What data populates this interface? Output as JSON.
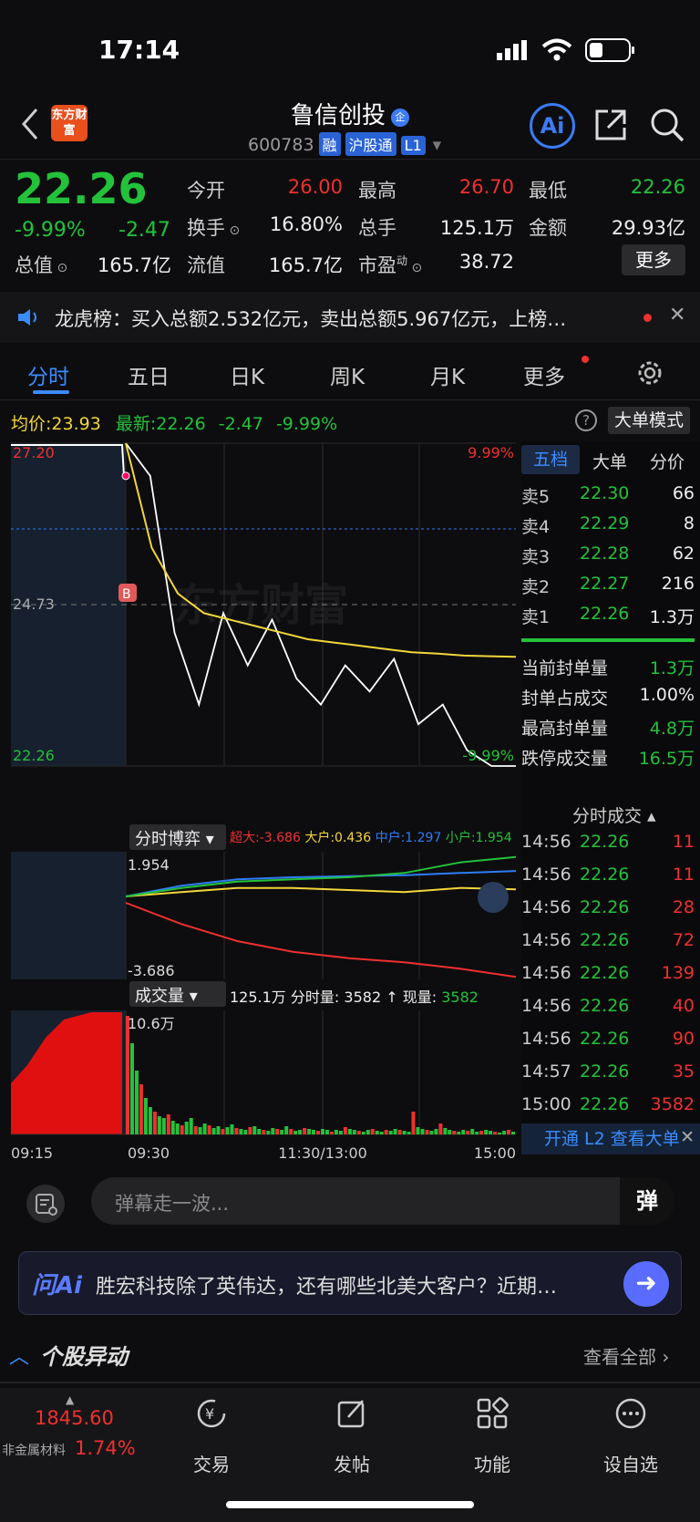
{
  "status": {
    "time": "17:14"
  },
  "header": {
    "title": "鲁信创投",
    "qi_badge": "企",
    "code": "600783",
    "tags": [
      "融",
      "沪股通",
      "L1"
    ],
    "logo_text": "东方财富",
    "ai_label": "Ai"
  },
  "quote": {
    "price": "22.26",
    "pct": "-9.99%",
    "chg": "-2.47",
    "row1": [
      {
        "label": "今开",
        "value": "26.00",
        "color": "red"
      },
      {
        "label": "最高",
        "value": "26.70",
        "color": "red"
      },
      {
        "label": "最低",
        "value": "22.26",
        "color": "green"
      }
    ],
    "row2": [
      {
        "label": "换手",
        "value": "16.80%"
      },
      {
        "label": "总手",
        "value": "125.1万"
      },
      {
        "label": "金额",
        "value": "29.93亿"
      }
    ],
    "row3": [
      {
        "label": "总值",
        "value": "165.7亿"
      },
      {
        "label": "流值",
        "value": "165.7亿"
      },
      {
        "label": "市盈",
        "sup": "动",
        "value": "38.72"
      }
    ],
    "more": "更多"
  },
  "notice": {
    "text": "龙虎榜：买入总额2.532亿元，卖出总额5.967亿元，上榜…"
  },
  "tabs": [
    "分时",
    "五日",
    "日K",
    "周K",
    "月K",
    "更多"
  ],
  "infobar": {
    "avg_label": "均价:",
    "avg": "23.93",
    "latest_label": "最新:",
    "latest": "22.26",
    "chg": "-2.47",
    "pct": "-9.99%",
    "mode": "大单模式"
  },
  "chart_data": [
    {
      "type": "line",
      "title": "分时",
      "x": [
        "09:15",
        "09:30",
        "11:30/13:00",
        "15:00"
      ],
      "yticks_left": [
        "27.20",
        "24.73",
        "22.26"
      ],
      "yticks_right": [
        "9.99%",
        "-9.99%"
      ],
      "ylim": [
        22.26,
        27.2
      ],
      "series": [
        {
          "name": "价格",
          "values": [
            27.2,
            26.7,
            24.3,
            23.2,
            24.6,
            23.8,
            24.5,
            23.6,
            23.2,
            23.8,
            23.4,
            23.9,
            22.9,
            23.2,
            22.5,
            22.26,
            22.26
          ]
        },
        {
          "name": "均价",
          "values": [
            27.2,
            25.6,
            24.9,
            24.6,
            24.5,
            24.4,
            24.3,
            24.2,
            24.15,
            24.1,
            24.05,
            24.0,
            23.98,
            23.95,
            23.94,
            23.93
          ]
        }
      ],
      "watermark": "东方财富"
    },
    {
      "type": "line",
      "title": "分时博弈",
      "legend": [
        {
          "name": "超大",
          "value": "-3.686",
          "color": "#f0302f"
        },
        {
          "name": "大户",
          "value": "0.436",
          "color": "#f3d53a"
        },
        {
          "name": "中户",
          "value": "1.297",
          "color": "#2f7cf6"
        },
        {
          "name": "小户",
          "value": "1.954",
          "color": "#23c23a"
        }
      ],
      "yticks": [
        "1.954",
        "-3.686"
      ],
      "series": [
        {
          "name": "超大",
          "values": [
            -0.2,
            -1.2,
            -2.0,
            -2.5,
            -2.8,
            -3.0,
            -3.3,
            -3.686
          ]
        },
        {
          "name": "大户",
          "values": [
            0.1,
            0.3,
            0.5,
            0.5,
            0.4,
            0.3,
            0.5,
            0.436
          ]
        },
        {
          "name": "中户",
          "values": [
            0.1,
            0.6,
            0.9,
            1.0,
            1.05,
            1.1,
            1.2,
            1.297
          ]
        },
        {
          "name": "小户",
          "values": [
            0.1,
            0.5,
            0.8,
            0.9,
            1.0,
            1.2,
            1.7,
            1.954
          ]
        }
      ]
    },
    {
      "type": "bar",
      "title": "成交量",
      "summary": "125.1万",
      "detail_label": "分时量:",
      "detail": "3582",
      "arrow": "↑",
      "now_label": "现量:",
      "now": "3582",
      "ymax_label": "10.6万"
    }
  ],
  "side_tabs": [
    "五档",
    "大单",
    "分价"
  ],
  "orderbook": [
    {
      "label": "卖5",
      "price": "22.30",
      "vol": "66"
    },
    {
      "label": "卖4",
      "price": "22.29",
      "vol": "8"
    },
    {
      "label": "卖3",
      "price": "22.28",
      "vol": "62"
    },
    {
      "label": "卖2",
      "price": "22.27",
      "vol": "216"
    },
    {
      "label": "卖1",
      "price": "22.26",
      "vol": "1.3万"
    }
  ],
  "seal": [
    {
      "label": "当前封单量",
      "value": "1.3万",
      "color": "green"
    },
    {
      "label": "封单占成交",
      "value": "1.00%",
      "color": "white"
    },
    {
      "label": "最高封单量",
      "value": "4.8万",
      "color": "green"
    },
    {
      "label": "跌停成交量",
      "value": "16.5万",
      "color": "green"
    }
  ],
  "ticks_title": "分时成交",
  "ticks": [
    {
      "t": "14:56",
      "p": "22.26",
      "v": "11"
    },
    {
      "t": "14:56",
      "p": "22.26",
      "v": "11"
    },
    {
      "t": "14:56",
      "p": "22.26",
      "v": "28"
    },
    {
      "t": "14:56",
      "p": "22.26",
      "v": "72"
    },
    {
      "t": "14:56",
      "p": "22.26",
      "v": "139"
    },
    {
      "t": "14:56",
      "p": "22.26",
      "v": "40"
    },
    {
      "t": "14:56",
      "p": "22.26",
      "v": "90"
    },
    {
      "t": "14:57",
      "p": "22.26",
      "v": "35"
    },
    {
      "t": "15:00",
      "p": "22.26",
      "v": "3582"
    }
  ],
  "l2": "开通 L2 查看大单",
  "danmu": {
    "placeholder": "弹幕走一波...",
    "btn": "弹"
  },
  "ask": {
    "brand": "问Ai",
    "text": "胜宏科技除了英伟达，还有哪些北美大客户？近期…"
  },
  "movement": {
    "title": "个股异动",
    "link": "查看全部"
  },
  "bottom": {
    "index_value": "1845.60",
    "index_name": "非金属材料",
    "index_pct": "1.74%",
    "nav": [
      "交易",
      "发帖",
      "功能",
      "设自选"
    ]
  }
}
